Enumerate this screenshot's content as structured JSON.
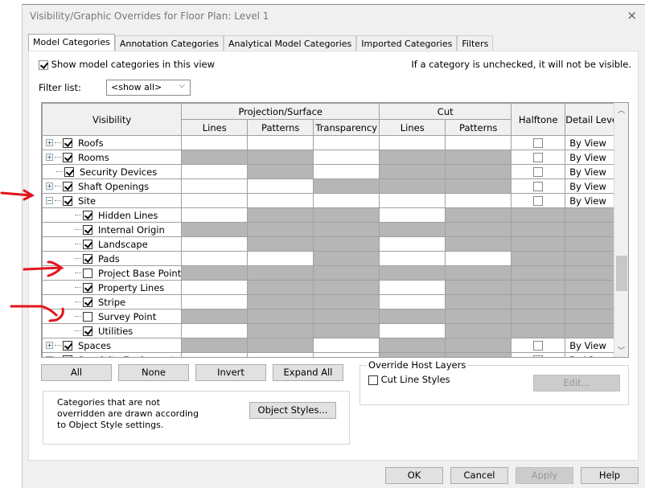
{
  "window": {
    "title": "Visibility/Graphic Overrides for Floor Plan: Level 1",
    "close_icon": "×"
  },
  "tabs": [
    {
      "label": "Model Categories",
      "active": true
    },
    {
      "label": "Annotation Categories"
    },
    {
      "label": "Analytical Model Categories"
    },
    {
      "label": "Imported Categories"
    },
    {
      "label": "Filters"
    }
  ],
  "show_model": {
    "label": "Show model categories in this view",
    "checked": true
  },
  "hint": "If a category is unchecked, it will not be visible.",
  "filter": {
    "label": "Filter list:",
    "value": "<show all>"
  },
  "table": {
    "headers": {
      "visibility": "Visibility",
      "projection": "Projection/Surface",
      "cut": "Cut",
      "halftone": "Halftone",
      "detail_level": "Detail Level",
      "lines": "Lines",
      "patterns": "Patterns",
      "transparency": "Transparency",
      "cut_lines": "Lines",
      "cut_patterns": "Patterns"
    },
    "cell_order": [
      "projection_lines",
      "projection_patterns",
      "transparency",
      "cut_lines",
      "cut_patterns",
      "halftone",
      "detail_level"
    ],
    "rows": [
      {
        "name": "Roofs",
        "level": 0,
        "expander": "+",
        "checked": true,
        "editable": [
          1,
          1,
          1,
          1,
          1,
          1,
          1
        ],
        "halftone": false,
        "detail": "By View"
      },
      {
        "name": "Rooms",
        "level": 0,
        "expander": "+",
        "checked": true,
        "editable": [
          0,
          0,
          1,
          0,
          0,
          1,
          1
        ],
        "halftone": false,
        "detail": "By View"
      },
      {
        "name": "Security Devices",
        "level": 0,
        "expander": "",
        "checked": true,
        "editable": [
          1,
          0,
          1,
          0,
          0,
          1,
          1
        ],
        "halftone": false,
        "detail": "By View"
      },
      {
        "name": "Shaft Openings",
        "level": 0,
        "expander": "+",
        "checked": true,
        "editable": [
          1,
          1,
          0,
          0,
          0,
          1,
          1
        ],
        "halftone": false,
        "detail": "By View"
      },
      {
        "name": "Site",
        "level": 0,
        "expander": "−",
        "checked": true,
        "editable": [
          1,
          1,
          1,
          1,
          1,
          1,
          1
        ],
        "halftone": false,
        "detail": "By View"
      },
      {
        "name": "Hidden Lines",
        "level": 1,
        "checked": true,
        "editable": [
          1,
          0,
          0,
          1,
          0,
          0,
          0
        ]
      },
      {
        "name": "Internal Origin",
        "level": 1,
        "checked": true,
        "editable": [
          0,
          0,
          0,
          0,
          0,
          0,
          0
        ]
      },
      {
        "name": "Landscape",
        "level": 1,
        "checked": true,
        "editable": [
          1,
          0,
          0,
          1,
          0,
          0,
          0
        ]
      },
      {
        "name": "Pads",
        "level": 1,
        "checked": true,
        "editable": [
          1,
          1,
          0,
          1,
          1,
          0,
          0
        ]
      },
      {
        "name": "Project Base Point",
        "level": 1,
        "checked": false,
        "editable": [
          0,
          0,
          0,
          0,
          0,
          0,
          0
        ]
      },
      {
        "name": "Property Lines",
        "level": 1,
        "checked": true,
        "editable": [
          1,
          0,
          0,
          1,
          0,
          0,
          0
        ]
      },
      {
        "name": "Stripe",
        "level": 1,
        "checked": true,
        "editable": [
          1,
          0,
          0,
          1,
          0,
          0,
          0
        ]
      },
      {
        "name": "Survey Point",
        "level": 1,
        "checked": false,
        "editable": [
          0,
          0,
          0,
          0,
          0,
          0,
          0
        ]
      },
      {
        "name": "Utilities",
        "level": 1,
        "checked": true,
        "editable": [
          1,
          0,
          0,
          1,
          0,
          0,
          0
        ]
      },
      {
        "name": "Spaces",
        "level": 0,
        "expander": "+",
        "checked": true,
        "editable": [
          0,
          0,
          1,
          0,
          0,
          1,
          1
        ],
        "halftone": false,
        "detail": "By View"
      },
      {
        "name": "Specialty Equipment",
        "level": 0,
        "expander": "+",
        "checked": true,
        "editable": [
          1,
          1,
          1,
          0,
          0,
          1,
          1
        ],
        "halftone": false,
        "detail": "By View"
      }
    ]
  },
  "buttons": {
    "all": "All",
    "none": "None",
    "invert": "Invert",
    "expand_all": "Expand All",
    "object_styles": "Object Styles...",
    "edit": "Edit...",
    "ok": "OK",
    "cancel": "Cancel",
    "apply": "Apply",
    "help": "Help"
  },
  "note": "Categories that are not overridden are drawn according to Object Style settings.",
  "override_host": {
    "title": "Override Host Layers",
    "cut_line_styles": "Cut Line Styles",
    "checked": false
  },
  "annotation_color": "#e3141b"
}
